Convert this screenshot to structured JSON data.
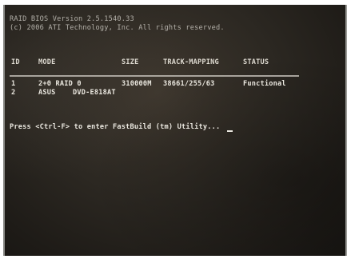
{
  "bios": {
    "version_line": "RAID BIOS Version 2.5.1540.33",
    "copyright_line": "(c) 2006 ATI Technology, Inc. All rights reserved."
  },
  "table": {
    "headers": [
      "ID",
      "MODE",
      "SIZE",
      "TRACK-MAPPING",
      "STATUS"
    ],
    "rows": [
      {
        "id": "1",
        "mode": "2+0 RAID 0",
        "size": "310000M",
        "track_mapping": "38661/255/63",
        "status": "Functional"
      },
      {
        "id": "2",
        "mode": "ASUS    DVD-E818AT",
        "size": "",
        "track_mapping": "",
        "status": ""
      }
    ]
  },
  "prompt": {
    "text": "Press <Ctrl-F> to enter FastBuild (tm) Utility..."
  }
}
